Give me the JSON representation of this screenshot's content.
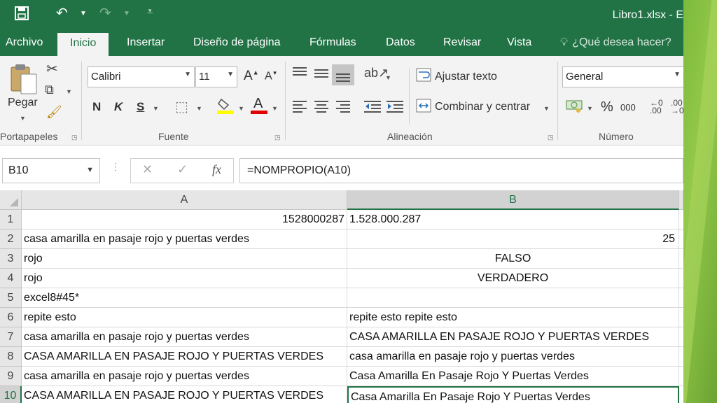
{
  "window": {
    "title": "Libro1.xlsx - E"
  },
  "quick_access": {
    "save_icon": "save-icon",
    "undo_icon": "undo-icon",
    "redo_icon": "redo-icon",
    "customize_icon": "customize-icon"
  },
  "tabs": [
    {
      "label": "Archivo"
    },
    {
      "label": "Inicio"
    },
    {
      "label": "Insertar"
    },
    {
      "label": "Diseño de página"
    },
    {
      "label": "Fórmulas"
    },
    {
      "label": "Datos"
    },
    {
      "label": "Revisar"
    },
    {
      "label": "Vista"
    },
    {
      "label": "¿Qué desea hacer?"
    }
  ],
  "ribbon": {
    "clipboard": {
      "paste_label": "Pegar",
      "group_label": "Portapapeles"
    },
    "font": {
      "font_name": "Calibri",
      "font_size": "11",
      "bold": "N",
      "italic": "K",
      "underline": "S",
      "group_label": "Fuente"
    },
    "alignment": {
      "wrap_text": "Ajustar texto",
      "merge_center": "Combinar y centrar",
      "group_label": "Alineación"
    },
    "number": {
      "format": "General",
      "percent": "%",
      "thousands": "000",
      "group_label": "Número"
    }
  },
  "formula_bar": {
    "name_box": "B10",
    "fx": "fx",
    "formula": "=NOMPROPIO(A10)"
  },
  "sheet": {
    "columns": [
      "A",
      "B"
    ],
    "rows": [
      {
        "n": "1",
        "a": "1528000287",
        "b": "1.528.000.287"
      },
      {
        "n": "2",
        "a": "casa amarilla en pasaje rojo y puertas verdes",
        "b": "25"
      },
      {
        "n": "3",
        "a": "rojo",
        "b": "FALSO"
      },
      {
        "n": "4",
        "a": "rojo",
        "b": "VERDADERO"
      },
      {
        "n": "5",
        "a": "excel8#45*",
        "b": ""
      },
      {
        "n": "6",
        "a": "repite esto",
        "b": "repite esto repite esto"
      },
      {
        "n": "7",
        "a": "casa amarilla en pasaje rojo y puertas verdes",
        "b": "CASA AMARILLA EN PASAJE ROJO Y PUERTAS VERDES"
      },
      {
        "n": "8",
        "a": "CASA AMARILLA EN PASAJE ROJO Y PUERTAS VERDES",
        "b": "casa amarilla en pasaje rojo y puertas verdes"
      },
      {
        "n": "9",
        "a": "casa amarilla en pasaje rojo y puertas verdes",
        "b": "Casa Amarilla En Pasaje Rojo Y Puertas Verdes"
      },
      {
        "n": "10",
        "a": "CASA AMARILLA EN PASAJE ROJO Y PUERTAS VERDES",
        "b": "Casa Amarilla En Pasaje Rojo Y Puertas Verdes"
      }
    ]
  },
  "colors": {
    "accent": "#217346",
    "ribbon_bg": "#f3f3f3"
  }
}
